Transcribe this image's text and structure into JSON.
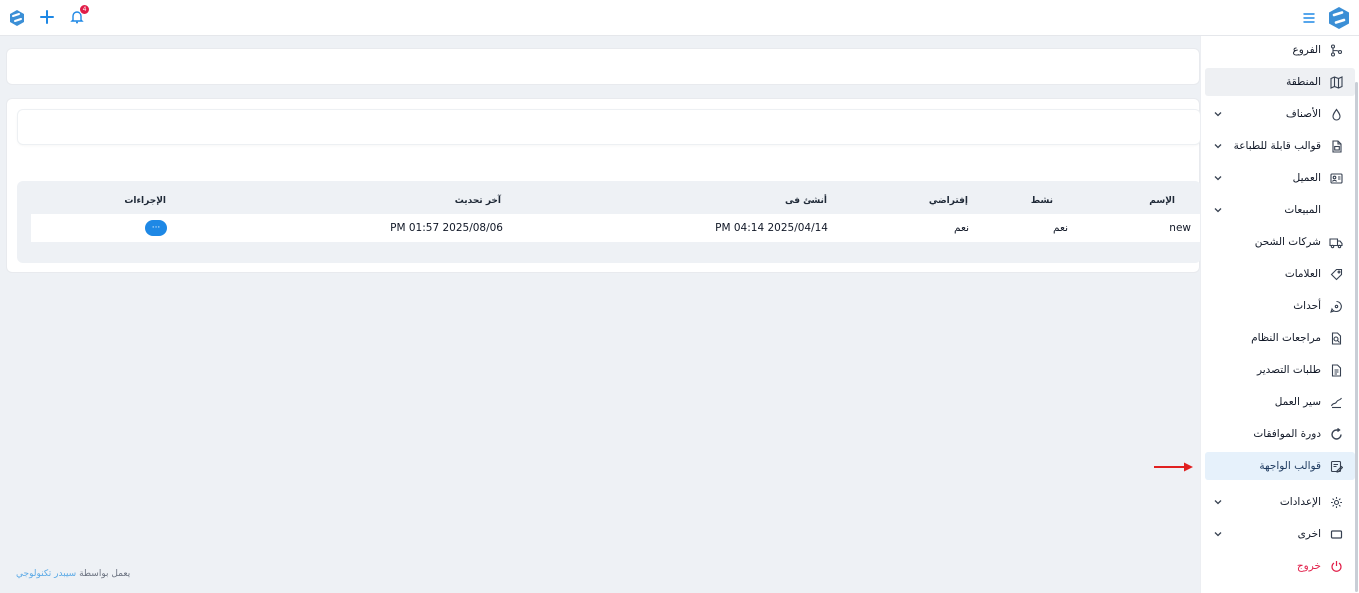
{
  "topbar": {
    "logo_icon": "app-logo-icon",
    "add_icon": "plus-icon",
    "notification_icon": "bell-icon",
    "notification_count": "4",
    "menu_icon": "hamburger-icon"
  },
  "sidebar": {
    "items": [
      {
        "label": "الفروع",
        "icon": "branches-icon",
        "chevron": false
      },
      {
        "label": "المنطقة",
        "icon": "map-icon",
        "chevron": false,
        "state": "highlighted"
      },
      {
        "label": "الأصناف",
        "icon": "drop-icon",
        "chevron": true
      },
      {
        "label": "قوالب قابلة للطباعة",
        "icon": "print-file-icon",
        "chevron": true
      },
      {
        "label": "العميل",
        "icon": "customer-icon",
        "chevron": true
      },
      {
        "label": "المبيعات",
        "icon": "currency-icon",
        "chevron": true
      },
      {
        "label": "شركات الشحن",
        "icon": "truck-icon",
        "chevron": false
      },
      {
        "label": "العلامات",
        "icon": "tag-icon",
        "chevron": false
      },
      {
        "label": "أحداث",
        "icon": "event-icon",
        "chevron": false
      },
      {
        "label": "مراجعات النظام",
        "icon": "audit-icon",
        "chevron": false
      },
      {
        "label": "طلبات التصدير",
        "icon": "export-icon",
        "chevron": false
      },
      {
        "label": "سير العمل",
        "icon": "workflow-icon",
        "chevron": false
      },
      {
        "label": "دورة الموافقات",
        "icon": "refresh-icon",
        "chevron": false
      },
      {
        "label": "قوالب الواجهة",
        "icon": "template-edit-icon",
        "chevron": false,
        "state": "active"
      },
      {
        "label": "الإعدادات",
        "icon": "gear-icon",
        "chevron": true
      },
      {
        "label": "اخرى",
        "icon": "rectangle-icon",
        "chevron": true
      },
      {
        "label": "خروج",
        "icon": "power-icon",
        "chevron": false,
        "state": "logout"
      }
    ]
  },
  "table": {
    "headers": {
      "name": "الإسم",
      "active": "نشط",
      "default": "إفتراضي",
      "created_at": "أنشئ فى",
      "updated_at": "آخر تحديث",
      "actions": "الإجراءات"
    },
    "rows": [
      {
        "name": "new",
        "active": "نعم",
        "default": "نعم",
        "created_at": "PM 04:14 2025/04/14",
        "updated_at": "PM 01:57 2025/08/06",
        "actions": "···"
      }
    ]
  },
  "footer": {
    "powered_by": "يعمل بواسطة",
    "brand": "سيبدر تكنولوجي"
  },
  "colors": {
    "accent": "#1e88e5",
    "logout": "#e11d48",
    "active_item_bg": "#e6f1fb",
    "annotation_arrow": "#e02020"
  }
}
